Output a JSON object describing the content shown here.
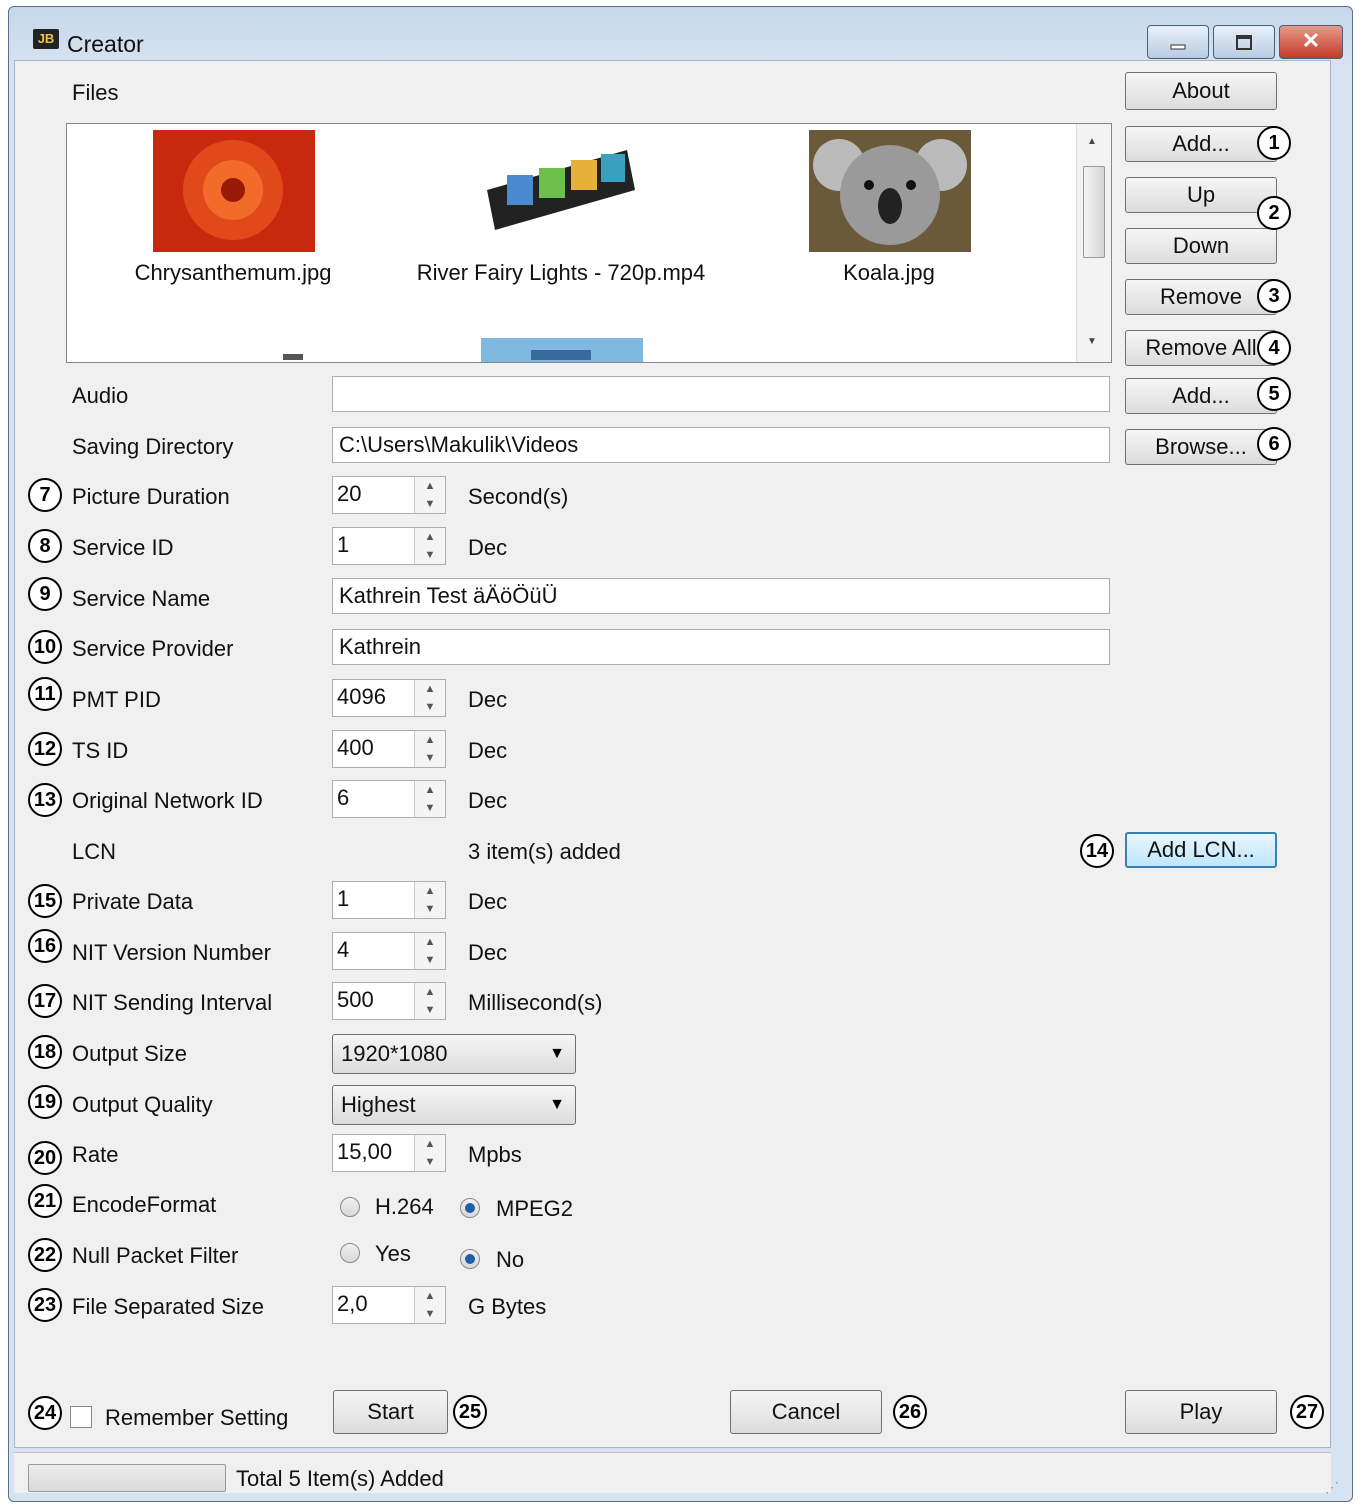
{
  "window": {
    "title": "Creator",
    "icon_label": "JB",
    "minimize_icon": "minimize-icon",
    "maximize_icon": "maximize-icon",
    "close_icon": "close-icon"
  },
  "about_label": "About",
  "files": {
    "label": "Files",
    "items": [
      {
        "name": "Chrysanthemum.jpg"
      },
      {
        "name": "River Fairy Lights - 720p.mp4"
      },
      {
        "name": "Koala.jpg"
      }
    ],
    "add_label": "Add...",
    "up_label": "Up",
    "down_label": "Down",
    "remove_label": "Remove",
    "remove_all_label": "Remove All"
  },
  "audio": {
    "label": "Audio",
    "value": "",
    "add_label": "Add..."
  },
  "saving_directory": {
    "label": "Saving Directory",
    "value": "C:\\Users\\Makulik\\Videos",
    "browse_label": "Browse..."
  },
  "picture_duration": {
    "label": "Picture Duration",
    "value": "20",
    "unit": "Second(s)"
  },
  "service_id": {
    "label": "Service ID",
    "value": "1",
    "unit": "Dec"
  },
  "service_name": {
    "label": "Service Name",
    "value": "Kathrein Test äÄöÖüÜ"
  },
  "service_provider": {
    "label": "Service Provider",
    "value": "Kathrein"
  },
  "pmt_pid": {
    "label": "PMT PID",
    "value": "4096",
    "unit": "Dec"
  },
  "ts_id": {
    "label": "TS ID",
    "value": "400",
    "unit": "Dec"
  },
  "original_network_id": {
    "label": "Original Network ID",
    "value": "6",
    "unit": "Dec"
  },
  "lcn": {
    "label": "LCN",
    "status": "3 item(s) added",
    "add_label": "Add LCN..."
  },
  "private_data": {
    "label": "Private Data",
    "value": "1",
    "unit": "Dec"
  },
  "nit_version": {
    "label": "NIT Version Number",
    "value": "4",
    "unit": "Dec"
  },
  "nit_interval": {
    "label": "NIT Sending Interval",
    "value": "500",
    "unit": "Millisecond(s)"
  },
  "output_size": {
    "label": "Output Size",
    "value": "1920*1080"
  },
  "output_quality": {
    "label": "Output Quality",
    "value": "Highest"
  },
  "rate": {
    "label": "Rate",
    "value": "15,00",
    "unit": "Mpbs"
  },
  "encode_format": {
    "label": "EncodeFormat",
    "option1": "H.264",
    "option2": "MPEG2",
    "selected": "MPEG2"
  },
  "null_packet_filter": {
    "label": "Null Packet Filter",
    "option1": "Yes",
    "option2": "No",
    "selected": "No"
  },
  "file_separated_size": {
    "label": "File Separated Size",
    "value": "2,0",
    "unit": "G Bytes"
  },
  "remember_setting": {
    "label": "Remember Setting",
    "checked": false
  },
  "actions": {
    "start": "Start",
    "cancel": "Cancel",
    "play": "Play"
  },
  "status_text": "Total 5 Item(s) Added",
  "callouts": [
    "1",
    "2",
    "3",
    "4",
    "5",
    "6",
    "7",
    "8",
    "9",
    "10",
    "11",
    "12",
    "13",
    "14",
    "15",
    "16",
    "17",
    "18",
    "19",
    "20",
    "21",
    "22",
    "23",
    "24",
    "25",
    "26",
    "27"
  ]
}
